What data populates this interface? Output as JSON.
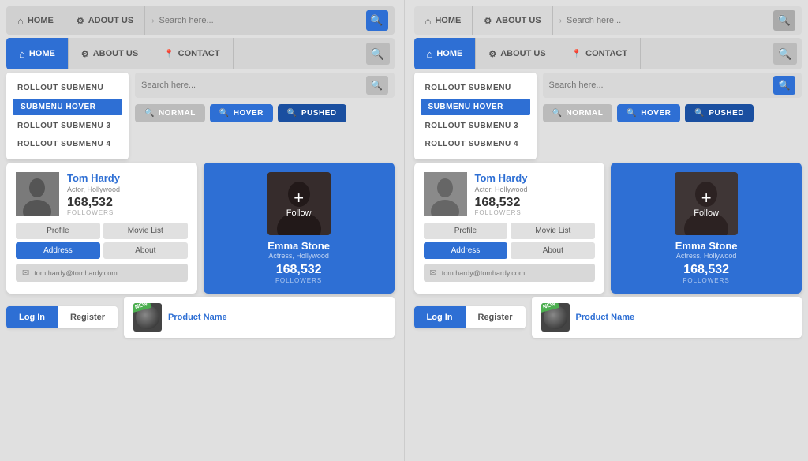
{
  "left_column": {
    "navbar_top": {
      "home_label": "HOME",
      "about_label": "ADOUT US",
      "search_placeholder": "Search here..."
    },
    "navbar_primary": {
      "home_label": "HOME",
      "about_label": "ABOUT US",
      "contact_label": "CONTACT"
    },
    "dropdown": {
      "items": [
        {
          "label": "ROLLOUT SUBMENU",
          "state": "normal"
        },
        {
          "label": "SUBMENU HOVER",
          "state": "hover"
        },
        {
          "label": "ROLLOUT SUBMENU 3",
          "state": "normal"
        },
        {
          "label": "ROLLOUT SUBMENU 4",
          "state": "normal"
        }
      ]
    },
    "search": {
      "placeholder": "Search here...",
      "btn_normal": "NORMAL",
      "btn_hover": "HOVER",
      "btn_pushed": "PUSHED"
    },
    "profile_card": {
      "name": "Tom Hardy",
      "title": "Actor, Hollywood",
      "followers_count": "168,532",
      "followers_label": "FOLLOWERS",
      "btn_profile": "Profile",
      "btn_movie": "Movie List",
      "btn_address": "Address",
      "btn_about": "About",
      "email": "tom.hardy@tomhardy.com"
    },
    "follow_card": {
      "name": "Emma Stone",
      "subtitle": "Actress, Hollywood",
      "followers_count": "168,532",
      "followers_label": "FOLLOWERS",
      "follow_label": "Follow",
      "plus_icon": "+"
    },
    "bottom": {
      "login_label": "Log In",
      "register_label": "Register",
      "product_name": "Product Name",
      "new_badge": "NEW"
    }
  },
  "right_column": {
    "navbar_top": {
      "home_label": "HOME",
      "about_label": "ABOUT US",
      "search_placeholder": "Search here..."
    },
    "navbar_primary": {
      "home_label": "HOME",
      "about_label": "ABOUT US",
      "contact_label": "CONTACT"
    },
    "dropdown": {
      "items": [
        {
          "label": "ROLLOUT SUBMENU",
          "state": "normal"
        },
        {
          "label": "SUBMENU HOVER",
          "state": "hover"
        },
        {
          "label": "ROLLOUT SUBMENU 3",
          "state": "normal"
        },
        {
          "label": "ROLLOUT SUBMENU 4",
          "state": "normal"
        }
      ]
    },
    "search": {
      "placeholder": "Search here...",
      "btn_normal": "NORMAL",
      "btn_hover": "HOVER",
      "btn_pushed": "PUSHED"
    },
    "profile_card": {
      "name": "Tom Hardy",
      "title": "Actor, Hollywood",
      "followers_count": "168,532",
      "followers_label": "FOLLOWERS",
      "btn_profile": "Profile",
      "btn_movie": "Movie List",
      "btn_address": "Address",
      "btn_about": "About",
      "email": "tom.hardy@tomhardy.com"
    },
    "follow_card": {
      "name": "Emma Stone",
      "subtitle": "Actress, Hollywood",
      "followers_count": "168,532",
      "followers_label": "FOLLOWERS",
      "follow_label": "Follow",
      "plus_icon": "+"
    },
    "bottom": {
      "login_label": "Log In",
      "register_label": "Register",
      "product_name": "Product Name",
      "new_badge": "NEW"
    }
  },
  "colors": {
    "blue": "#2e6fd4",
    "dark_blue": "#1a4fa0",
    "gray": "#d0d0d0",
    "light_gray": "#e0e0e0",
    "white": "#ffffff"
  }
}
